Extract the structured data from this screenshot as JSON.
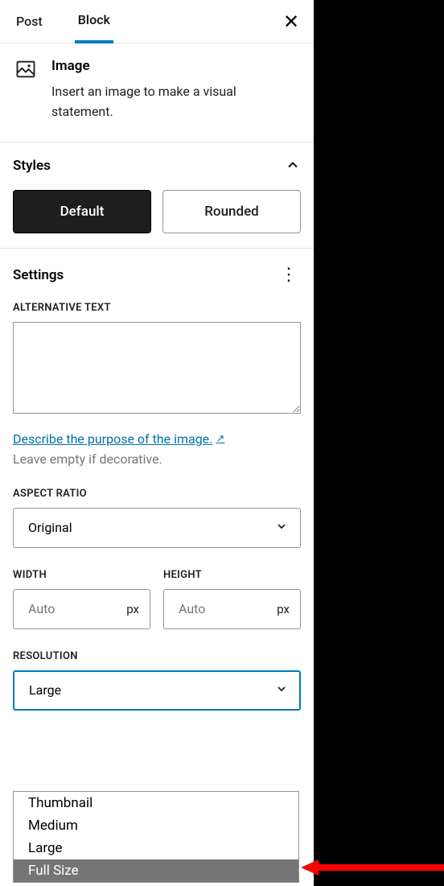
{
  "tabs": {
    "post": "Post",
    "block": "Block"
  },
  "block": {
    "name": "Image",
    "description": "Insert an image to make a visual statement."
  },
  "styles": {
    "title": "Styles",
    "default": "Default",
    "rounded": "Rounded"
  },
  "settings": {
    "title": "Settings",
    "alt_label": "Alternative Text",
    "alt_value": "",
    "describe_link": "Describe the purpose of the image.",
    "decorative_help": "Leave empty if decorative.",
    "aspect_label": "Aspect Ratio",
    "aspect_value": "Original",
    "width_label": "Width",
    "height_label": "Height",
    "auto_placeholder": "Auto",
    "unit": "px",
    "resolution_label": "Resolution",
    "resolution_value": "Large",
    "resolution_options": {
      "thumbnail": "Thumbnail",
      "medium": "Medium",
      "large": "Large",
      "full": "Full Size"
    }
  }
}
